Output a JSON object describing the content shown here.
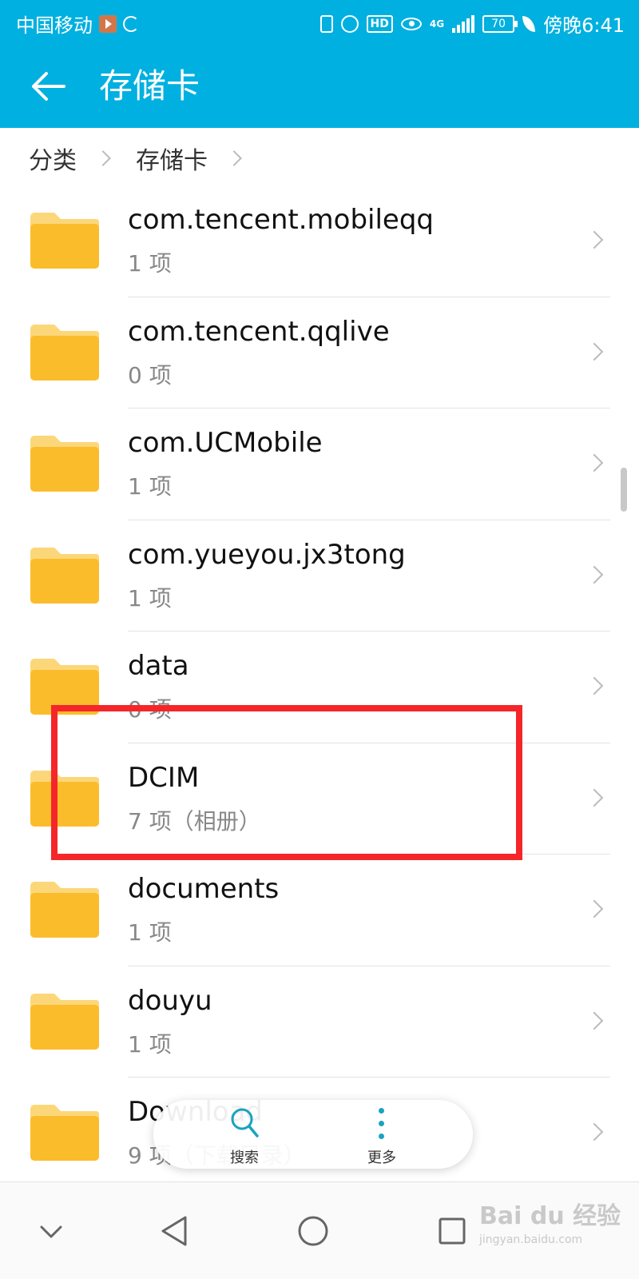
{
  "status_bar": {
    "carrier": "中国移动",
    "network": "4G",
    "battery": "70",
    "time": "傍晚6:41"
  },
  "app_bar": {
    "title": "存储卡"
  },
  "breadcrumb": [
    "分类",
    "存储卡"
  ],
  "files": [
    {
      "name": "com.tencent.mobileqq",
      "count": "1 项"
    },
    {
      "name": "com.tencent.qqlive",
      "count": "0 项"
    },
    {
      "name": "com.UCMobile",
      "count": "1 项"
    },
    {
      "name": "com.yueyou.jx3tong",
      "count": "1 项"
    },
    {
      "name": "data",
      "count": "0 项"
    },
    {
      "name": "DCIM",
      "count": "7 项（相册）"
    },
    {
      "name": "documents",
      "count": "1 项"
    },
    {
      "name": "douyu",
      "count": "1 项"
    },
    {
      "name": "Download",
      "count": "9 项（下载目录）"
    }
  ],
  "toolbar": {
    "search_label": "搜索",
    "more_label": "更多"
  },
  "watermark": {
    "main": "Bai du 经验",
    "sub": "jingyan.baidu.com"
  },
  "colors": {
    "app_bar": "#00b0e0",
    "folder": "#fbbc2c",
    "folder_tab": "#fcd77a",
    "highlight": "#f4262a",
    "accent": "#19a3c0"
  }
}
